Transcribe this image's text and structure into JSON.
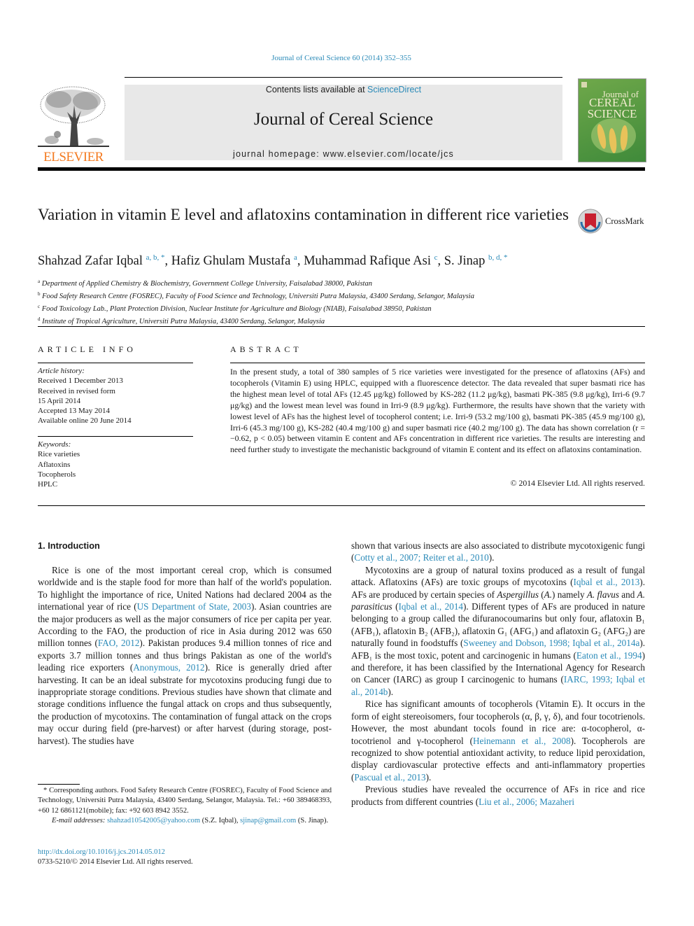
{
  "header": {
    "citation": "Journal of Cereal Science 60 (2014) 352–355",
    "contents_prefix": "Contents lists available at ",
    "contents_link": "ScienceDirect",
    "journal_title": "Journal of Cereal Science",
    "homepage": "journal homepage: www.elsevier.com/locate/jcs",
    "publisher_logo": "ELSEVIER",
    "cover_line1": "Journal of",
    "cover_line2": "CEREAL",
    "cover_line3": "SCIENCE",
    "crossmark": "CrossMark",
    "colors": {
      "link": "#2a8ab8",
      "banner": "#e8e8e8",
      "elsevier_orange": "#f47a20"
    }
  },
  "article": {
    "title": "Variation in vitamin E level and aflatoxins contamination in different rice varieties",
    "authors": [
      {
        "name": "Shahzad Zafar Iqbal",
        "sup": "a, b, *"
      },
      {
        "name": "Hafiz Ghulam Mustafa",
        "sup": "a"
      },
      {
        "name": "Muhammad Rafique Asi",
        "sup": "c"
      },
      {
        "name": "S. Jinap",
        "sup": "b, d, *"
      }
    ],
    "affiliations": [
      {
        "key": "a",
        "text": "Department of Applied Chemistry & Biochemistry, Government College University, Faisalabad 38000, Pakistan"
      },
      {
        "key": "b",
        "text": "Food Safety Research Centre (FOSREC), Faculty of Food Science and Technology, Universiti Putra Malaysia, 43400 Serdang, Selangor, Malaysia"
      },
      {
        "key": "c",
        "text": "Food Toxicology Lab., Plant Protection Division, Nuclear Institute for Agriculture and Biology (NIAB), Faisalabad 38950, Pakistan"
      },
      {
        "key": "d",
        "text": "Institute of Tropical Agriculture, Universiti Putra Malaysia, 43400 Serdang, Selangor, Malaysia"
      }
    ]
  },
  "article_info": {
    "heading": "ARTICLE INFO",
    "history_label": "Article history:",
    "history": [
      "Received 1 December 2013",
      "Received in revised form",
      "15 April 2014",
      "Accepted 13 May 2014",
      "Available online 20 June 2014"
    ],
    "keywords_label": "Keywords:",
    "keywords": [
      "Rice varieties",
      "Aflatoxins",
      "Tocopherols",
      "HPLC"
    ]
  },
  "abstract": {
    "heading": "ABSTRACT",
    "text": "In the present study, a total of 380 samples of 5 rice varieties were investigated for the presence of aflatoxins (AFs) and tocopherols (Vitamin E) using HPLC, equipped with a fluorescence detector. The data revealed that super basmati rice has the highest mean level of total AFs (12.45 μg/kg) followed by KS-282 (11.2 μg/kg), basmati PK-385 (9.8 μg/kg), Irri-6 (9.7 μg/kg) and the lowest mean level was found in Irri-9 (8.9 μg/kg). Furthermore, the results have shown that the variety with lowest level of AFs has the highest level of tocopherol content; i.e. Irri-9 (53.2 mg/100 g), basmati PK-385 (45.9 mg/100 g), Irri-6 (45.3 mg/100 g), KS-282 (40.4 mg/100 g) and super basmati rice (40.2 mg/100 g). The data has shown correlation (r = −0.62, p < 0.05) between vitamin E content and AFs concentration in different rice varieties. The results are interesting and need further study to investigate the mechanistic background of vitamin E content and its effect on aflatoxins contamination.",
    "copyright": "© 2014 Elsevier Ltd. All rights reserved."
  },
  "body": {
    "section_heading": "1.  Introduction",
    "left_paragraphs": [
      [
        {
          "t": "Rice is one of the most important cereal crop, which is consumed worldwide and is the staple food for more than half of the world's population. To highlight the importance of rice, United Nations had declared 2004 as the international year of rice ("
        },
        {
          "t": "US Department of State, 2003",
          "link": true
        },
        {
          "t": "). Asian countries are the major producers as well as the major consumers of rice per capita per year. According to the FAO, the production of rice in Asia during 2012 was 650 million tonnes ("
        },
        {
          "t": "FAO, 2012",
          "link": true
        },
        {
          "t": "). Pakistan produces 9.4 million tonnes of rice and exports 3.7 million tonnes and thus brings Pakistan as one of the world's leading rice exporters ("
        },
        {
          "t": "Anonymous, 2012",
          "link": true
        },
        {
          "t": "). Rice is generally dried after harvesting. It can be an ideal substrate for mycotoxins producing fungi due to inappropriate storage conditions. Previous studies have shown that climate and storage conditions influence the fungal attack on crops and thus subsequently, the production of mycotoxins. The contamination of fungal attack on the crops may occur during field (pre-harvest) or after harvest (during storage, post-harvest). The studies have"
        }
      ]
    ],
    "right_paragraphs": [
      [
        {
          "t": "shown that various insects are also associated to distribute mycotoxigenic fungi ("
        },
        {
          "t": "Cotty et al., 2007; Reiter et al., 2010",
          "link": true
        },
        {
          "t": ")."
        }
      ],
      [
        {
          "t": "Mycotoxins are a group of natural toxins produced as a result of fungal attack. Aflatoxins (AFs) are toxic groups of mycotoxins ("
        },
        {
          "t": "Iqbal et al., 2013",
          "link": true
        },
        {
          "t": "). AFs are produced by certain species of "
        },
        {
          "t": "Aspergillus",
          "italic": true
        },
        {
          "t": " ("
        },
        {
          "t": "A.",
          "italic": true
        },
        {
          "t": ") namely "
        },
        {
          "t": "A. flavus",
          "italic": true
        },
        {
          "t": " and "
        },
        {
          "t": "A. parasiticus",
          "italic": true
        },
        {
          "t": " ("
        },
        {
          "t": "Iqbal et al., 2014",
          "link": true
        },
        {
          "t": "). Different types of AFs are produced in nature belonging to a group called the difuranocoumarins but only four, aflatoxin B₁ (AFB₁), aflatoxin B₂ (AFB₂), aflatoxin G₁ (AFG₁) and aflatoxin G₂ (AFG₂) are naturally found in foodstuffs ("
        },
        {
          "t": "Sweeney and Dobson, 1998; Iqbal et al., 2014a",
          "link": true
        },
        {
          "t": "). AFB₁ is the most toxic, potent and carcinogenic in humans ("
        },
        {
          "t": "Eaton et al., 1994",
          "link": true
        },
        {
          "t": ") and therefore, it has been classified by the International Agency for Research on Cancer (IARC) as group I carcinogenic to humans ("
        },
        {
          "t": "IARC, 1993; Iqbal et al., 2014b",
          "link": true
        },
        {
          "t": ")."
        }
      ],
      [
        {
          "t": "Rice has significant amounts of tocopherols (Vitamin E). It occurs in the form of eight stereoisomers, four tocopherols (α, β, γ, δ), and four tocotrienols. However, the most abundant tocols found in rice are: α-tocopherol, α-tocotrienol and γ-tocopherol ("
        },
        {
          "t": "Heinemann et al., 2008",
          "link": true
        },
        {
          "t": "). Tocopherols are recognized to show potential antioxidant activity, to reduce lipid peroxidation, display cardiovascular protective effects and anti-inflammatory properties ("
        },
        {
          "t": "Pascual et al., 2013",
          "link": true
        },
        {
          "t": ")."
        }
      ],
      [
        {
          "t": "Previous studies have revealed the occurrence of AFs in rice and rice products from different countries ("
        },
        {
          "t": "Liu et al., 2006; Mazaheri",
          "link": true
        }
      ]
    ]
  },
  "footnote": {
    "corresponding": "* Corresponding authors. Food Safety Research Centre (FOSREC), Faculty of Food Science and Technology, Universiti Putra Malaysia, 43400 Serdang, Selangor, Malaysia. Tel.: +60 389468393, +60 12 6861121(mobile); fax: +92 603 8942 3552.",
    "email_label": "E-mail addresses:",
    "email1": "shahzad10542005@yahoo.com",
    "email1_owner": " (S.Z. Iqbal), ",
    "email2": "sjinap@gmail.com",
    "email2_owner": " (S. Jinap).",
    "doi": "http://dx.doi.org/10.1016/j.jcs.2014.05.012",
    "issn": "0733-5210/© 2014 Elsevier Ltd. All rights reserved."
  }
}
